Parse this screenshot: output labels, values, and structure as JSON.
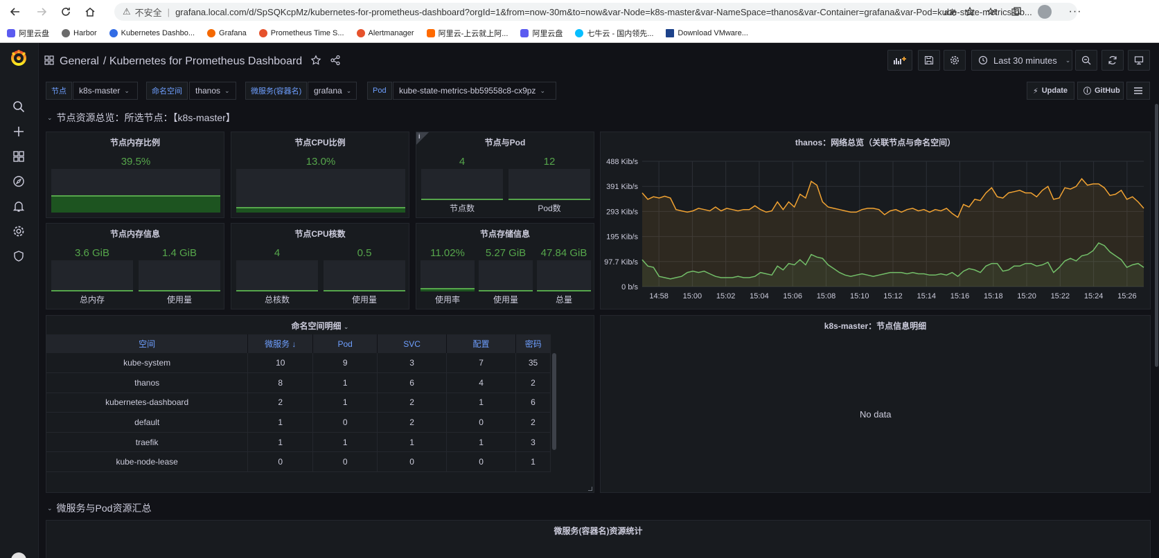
{
  "browser": {
    "insecure": "不安全",
    "url": "grafana.local.com/d/SpSQKcpMz/kubernetes-for-prometheus-dashboard?orgId=1&from=now-30m&to=now&var-Node=k8s-master&var-NameSpace=thanos&var-Container=grafana&var-Pod=kube-state-metrics-bb...",
    "bookmarks": [
      {
        "label": "阿里云盘",
        "color": "#5b5bf0"
      },
      {
        "label": "Harbor",
        "color": "#6b6b6b"
      },
      {
        "label": "Kubernetes Dashbo...",
        "color": "#326ce5"
      },
      {
        "label": "Grafana",
        "color": "#f46800"
      },
      {
        "label": "Prometheus Time S...",
        "color": "#e6522c"
      },
      {
        "label": "Alertmanager",
        "color": "#e6522c"
      },
      {
        "label": "阿里云-上云就上阿...",
        "color": "#ff6a00"
      },
      {
        "label": "阿里云盘",
        "color": "#5b5bf0"
      },
      {
        "label": "七牛云 - 国内领先...",
        "color": "#07beff"
      },
      {
        "label": "Download VMware...",
        "color": "#1d428a"
      }
    ]
  },
  "header": {
    "folder": "General",
    "title": "/ Kubernetes for Prometheus Dashboard",
    "time_range": "Last 30 minutes"
  },
  "variables": [
    {
      "label": "节点",
      "value": "k8s-master"
    },
    {
      "label": "命名空间",
      "value": "thanos"
    },
    {
      "label": "微服务(容器名)",
      "value": "grafana"
    },
    {
      "label": "Pod",
      "value": "kube-state-metrics-bb59558c8-cx9pz"
    }
  ],
  "links": {
    "update": "Update",
    "github": "GitHub"
  },
  "row1": {
    "title": "节点资源总览：所选节点：【k8s-master】"
  },
  "row2": {
    "title": "微服务与Pod资源汇总"
  },
  "panels": {
    "mem_ratio": {
      "title": "节点内存比例",
      "value": "39.5%",
      "fill": 0.395
    },
    "cpu_ratio": {
      "title": "节点CPU比例",
      "value": "13.0%",
      "fill": 0.13
    },
    "node_pod": {
      "title": "节点与Pod",
      "nodes": "4",
      "pods": "12",
      "nodes_label": "节点数",
      "pods_label": "Pod数"
    },
    "mem_info": {
      "title": "节点内存信息",
      "total": "3.6 GiB",
      "used": "1.4 GiB",
      "total_label": "总内存",
      "used_label": "使用量"
    },
    "cpu_info": {
      "title": "节点CPU核数",
      "total": "4",
      "used": "0.5",
      "total_label": "总核数",
      "used_label": "使用量"
    },
    "disk_info": {
      "title": "节点存储信息",
      "rate": "11.02%",
      "used": "5.27 GiB",
      "total": "47.84 GiB",
      "rate_label": "使用率",
      "used_label": "使用量",
      "total_label": "总量",
      "rate_fill": 0.1102
    },
    "ns_table": {
      "title": "命名空间明细",
      "headers": [
        "空间",
        "微服务 ↓",
        "Pod",
        "SVC",
        "配置",
        "密码"
      ],
      "rows": [
        [
          "kube-system",
          "10",
          "9",
          "3",
          "7",
          "35"
        ],
        [
          "thanos",
          "8",
          "1",
          "6",
          "4",
          "2"
        ],
        [
          "kubernetes-dashboard",
          "2",
          "1",
          "2",
          "1",
          "6"
        ],
        [
          "default",
          "1",
          "0",
          "2",
          "0",
          "2"
        ],
        [
          "traefik",
          "1",
          "1",
          "1",
          "1",
          "3"
        ],
        [
          "kube-node-lease",
          "0",
          "0",
          "0",
          "0",
          "1"
        ]
      ]
    },
    "node_detail": {
      "title": "k8s-master：节点信息明细",
      "nodata": "No data"
    },
    "svc_stats": {
      "title": "微服务(容器名)资源统计"
    }
  },
  "chart_data": {
    "type": "area",
    "title": "thanos：网络总览（关联节点与命名空间）",
    "yticks": [
      "0 b/s",
      "97.7 Kib/s",
      "195 Kib/s",
      "293 Kib/s",
      "391 Kib/s",
      "488 Kib/s"
    ],
    "ylim": [
      0,
      488
    ],
    "xticks": [
      "14:58",
      "15:00",
      "15:02",
      "15:04",
      "15:06",
      "15:08",
      "15:10",
      "15:12",
      "15:14",
      "15:16",
      "15:18",
      "15:20",
      "15:22",
      "15:24",
      "15:26"
    ],
    "xlim": [
      "14:57",
      "15:27"
    ],
    "grid": true,
    "series": [
      {
        "color": "#f2a332",
        "values": [
          365,
          340,
          350,
          345,
          352,
          345,
          300,
          295,
          290,
          295,
          305,
          300,
          295,
          310,
          295,
          305,
          300,
          295,
          300,
          300,
          315,
          300,
          290,
          295,
          330,
          300,
          330,
          310,
          360,
          345,
          410,
          395,
          330,
          310,
          305,
          300,
          295,
          290,
          290,
          300,
          305,
          305,
          300,
          280,
          295,
          300,
          290,
          300,
          305,
          295,
          300,
          290,
          300,
          295,
          305,
          285,
          270,
          320,
          310,
          340,
          335,
          365,
          385,
          350,
          345,
          365,
          370,
          375,
          365,
          365,
          350,
          375,
          390,
          340,
          345,
          385,
          380,
          390,
          420,
          395,
          400,
          400,
          385,
          355,
          360,
          375,
          340,
          350,
          330,
          305
        ]
      },
      {
        "color": "#73bf69",
        "values": [
          105,
          80,
          75,
          40,
          35,
          30,
          35,
          40,
          55,
          60,
          55,
          60,
          50,
          40,
          35,
          35,
          35,
          40,
          35,
          35,
          40,
          55,
          50,
          45,
          80,
          65,
          90,
          85,
          105,
          85,
          125,
          115,
          110,
          85,
          70,
          55,
          45,
          40,
          45,
          50,
          45,
          40,
          45,
          50,
          55,
          55,
          55,
          50,
          55,
          50,
          50,
          45,
          45,
          50,
          45,
          55,
          40,
          60,
          70,
          65,
          55,
          80,
          90,
          90,
          60,
          65,
          80,
          80,
          90,
          90,
          80,
          85,
          95,
          55,
          75,
          100,
          110,
          100,
          120,
          125,
          140,
          170,
          160,
          135,
          120,
          105,
          75,
          85,
          90,
          75
        ]
      }
    ]
  }
}
